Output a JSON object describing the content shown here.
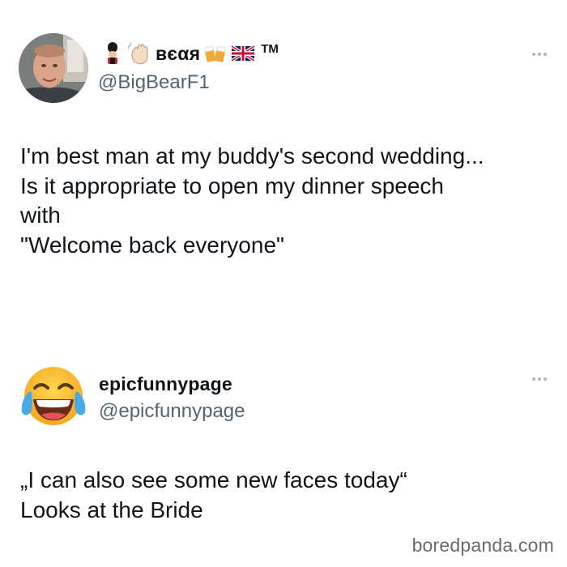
{
  "posts": [
    {
      "display_name": "ʙєαя",
      "name_emojis": [
        "guard-emoji",
        "waving-hand-emoji",
        "beer-mugs-emoji",
        "uk-flag-emoji"
      ],
      "trademark": "TM",
      "handle": "@BigBearF1",
      "text": "I'm best man at my buddy's second wedding...\nIs it appropriate to open my dinner speech\nwith\n\"Welcome back everyone\"",
      "avatar": "profile-photo"
    },
    {
      "display_name": "epicfunnypage",
      "handle": "@epicfunnypage",
      "text": "„I can also see some new faces today“\nLooks at the Bride",
      "avatar": "tears-of-joy-emoji"
    }
  ],
  "watermark": "boredpanda.com",
  "colors": {
    "text": "#0f1419",
    "handle": "#536471",
    "more_dots": "#aab8c2",
    "background": "#ffffff"
  }
}
